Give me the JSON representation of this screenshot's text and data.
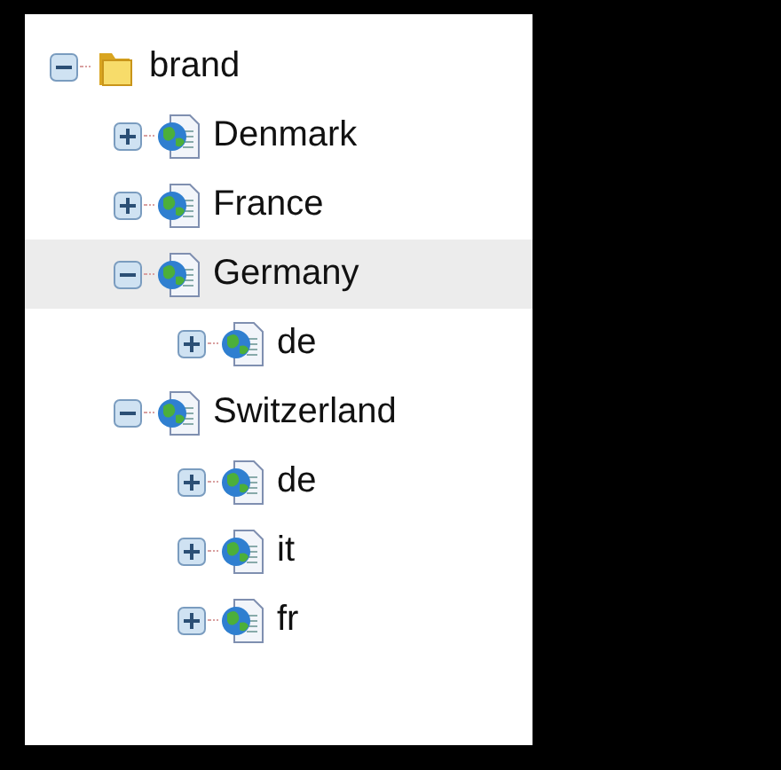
{
  "tree": [
    {
      "label": "brand",
      "kind": "folder",
      "expanded": true,
      "selected": false,
      "children": [
        {
          "label": "Denmark",
          "kind": "page",
          "expanded": false,
          "selected": false
        },
        {
          "label": "France",
          "kind": "page",
          "expanded": false,
          "selected": false
        },
        {
          "label": "Germany",
          "kind": "page",
          "expanded": true,
          "selected": true,
          "children": [
            {
              "label": "de",
              "kind": "page",
              "expanded": false,
              "selected": false
            }
          ]
        },
        {
          "label": "Switzerland",
          "kind": "page",
          "expanded": true,
          "selected": false,
          "children": [
            {
              "label": "de",
              "kind": "page",
              "expanded": false,
              "selected": false
            },
            {
              "label": "it",
              "kind": "page",
              "expanded": false,
              "selected": false
            },
            {
              "label": "fr",
              "kind": "page",
              "expanded": false,
              "selected": false
            }
          ]
        }
      ]
    }
  ]
}
